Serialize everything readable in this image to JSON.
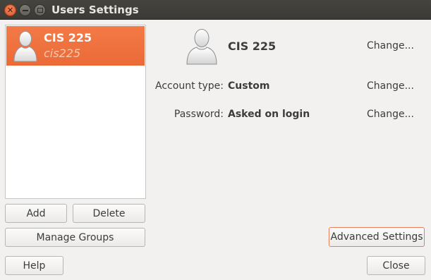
{
  "window": {
    "title": "Users Settings",
    "controls": [
      "close-icon",
      "minimize-icon",
      "maximize-icon"
    ]
  },
  "user_list": {
    "selected_index": 0,
    "items": [
      {
        "name": "CIS 225",
        "login": "cis225",
        "icon": "user-avatar-icon"
      }
    ]
  },
  "list_buttons": {
    "add_label": "Add",
    "delete_label": "Delete",
    "manage_groups_label": "Manage Groups"
  },
  "details": {
    "name": "CIS 225",
    "name_change": "Change...",
    "account_type_label": "Account type:",
    "account_type_value": "Custom",
    "account_type_change": "Change...",
    "password_label": "Password:",
    "password_value": "Asked on login",
    "password_change": "Change...",
    "advanced_label": "Advanced Settings"
  },
  "footer": {
    "help_label": "Help",
    "close_label": "Close"
  },
  "colors": {
    "accent": "#f07746",
    "titlebar": "#3c3b37"
  }
}
